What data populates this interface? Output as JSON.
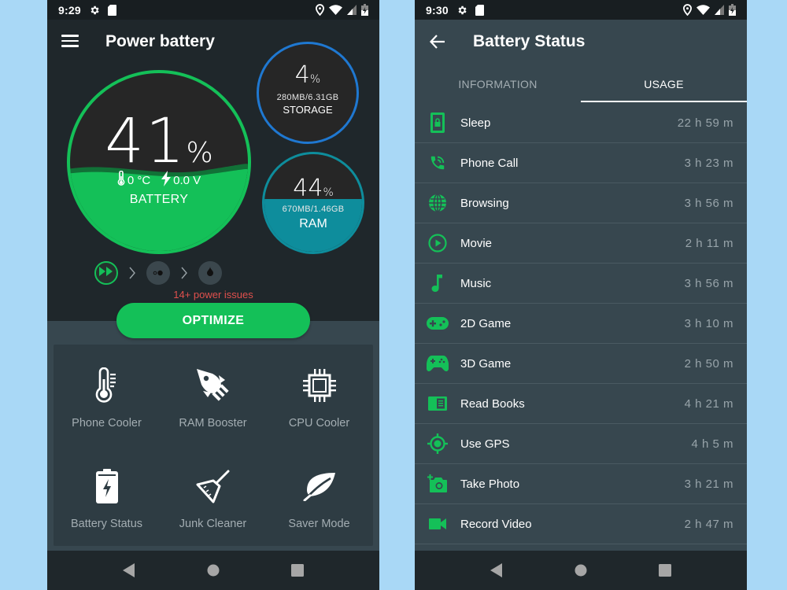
{
  "colors": {
    "background": "#a9d8f6",
    "accent_green": "#14c058",
    "storage_blue": "#1f78d1",
    "ram_teal": "#0e8d9c",
    "issues_red": "#e0504d"
  },
  "left_screen": {
    "status_bar": {
      "time": "9:29",
      "icons": [
        "gear-icon",
        "sd-card-icon",
        "location-icon",
        "wifi-icon",
        "signal-icon",
        "battery-charging-icon"
      ]
    },
    "app_title": "Power battery",
    "battery": {
      "percent_value": "41",
      "percent_unit": "%",
      "temperature": "0 °C",
      "voltage": "0.0 V",
      "label": "BATTERY",
      "level": 0.41
    },
    "storage": {
      "percent_value": "4",
      "percent_unit": "%",
      "usage": "280MB/6.31GB",
      "label": "STORAGE",
      "level": 0.04
    },
    "ram": {
      "percent_value": "44",
      "percent_unit": "%",
      "usage": "670MB/1.46GB",
      "label": "RAM",
      "level": 0.44
    },
    "steps": [
      "fast-forward-icon",
      "bubbles-icon",
      "drop-icon"
    ],
    "issues_text": "14+ power issues",
    "optimize_label": "OPTIMIZE",
    "tools": [
      {
        "label": "Phone Cooler",
        "icon": "thermometer-icon"
      },
      {
        "label": "RAM Booster",
        "icon": "rocket-icon"
      },
      {
        "label": "CPU Cooler",
        "icon": "cpu-chip-icon"
      },
      {
        "label": "Battery Status",
        "icon": "battery-bolt-icon"
      },
      {
        "label": "Junk Cleaner",
        "icon": "broom-icon"
      },
      {
        "label": "Saver Mode",
        "icon": "leaf-icon"
      }
    ]
  },
  "right_screen": {
    "status_bar": {
      "time": "9:30",
      "icons": [
        "gear-icon",
        "sd-card-icon",
        "location-icon",
        "wifi-icon",
        "signal-icon",
        "battery-charging-icon"
      ]
    },
    "title": "Battery Status",
    "tabs": [
      {
        "label": "INFORMATION",
        "active": false
      },
      {
        "label": "USAGE",
        "active": true
      }
    ],
    "usage": [
      {
        "label": "Sleep",
        "time": "22 h 59 m",
        "icon": "phone-lock-icon"
      },
      {
        "label": "Phone Call",
        "time": "3 h 23 m",
        "icon": "phone-call-icon"
      },
      {
        "label": "Browsing",
        "time": "3 h 56 m",
        "icon": "globe-icon"
      },
      {
        "label": "Movie",
        "time": "2 h 11 m",
        "icon": "play-circle-icon"
      },
      {
        "label": "Music",
        "time": "3 h 56 m",
        "icon": "music-note-icon"
      },
      {
        "label": "2D Game",
        "time": "3 h 10 m",
        "icon": "gamepad-icon"
      },
      {
        "label": "3D Game",
        "time": "2 h 50 m",
        "icon": "controller-icon"
      },
      {
        "label": "Read Books",
        "time": "4 h 21 m",
        "icon": "book-icon"
      },
      {
        "label": "Use GPS",
        "time": "4 h 5 m",
        "icon": "gps-target-icon"
      },
      {
        "label": "Take Photo",
        "time": "3 h 21 m",
        "icon": "add-photo-icon"
      },
      {
        "label": "Record Video",
        "time": "2 h 47 m",
        "icon": "video-camera-icon"
      }
    ]
  },
  "navbar": [
    "back-icon",
    "home-icon",
    "recents-icon"
  ]
}
